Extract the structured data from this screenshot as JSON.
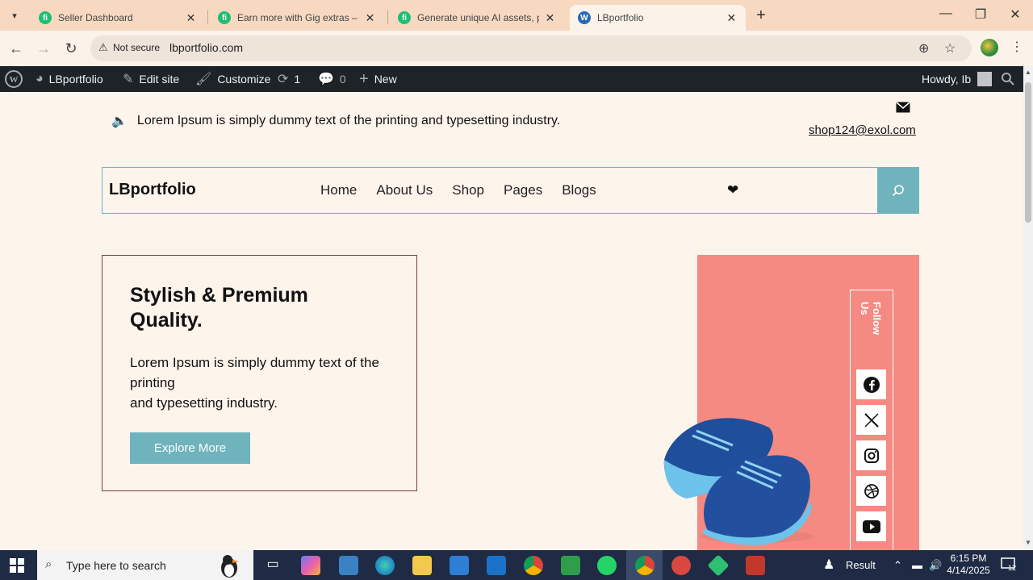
{
  "browser": {
    "tabs": [
      {
        "title": "Seller Dashboard",
        "favicon": "fiverr-icon"
      },
      {
        "title": "Earn more with Gig extras – Fiverr",
        "favicon": "fiverr-icon"
      },
      {
        "title": "Generate unique AI assets, pow",
        "favicon": "fiverr-icon"
      },
      {
        "title": "LBportfolio",
        "favicon": "wordpress-icon"
      }
    ],
    "security_label": "Not secure",
    "url": "lbportfolio.com"
  },
  "adminbar": {
    "site_name": "LBportfolio",
    "edit_site": "Edit site",
    "customize": "Customize",
    "updates_count": "1",
    "comments_count": "0",
    "new_label": "New",
    "howdy": "Howdy, Ib"
  },
  "page": {
    "announcement": "Lorem Ipsum is simply dummy text of the printing and typesetting industry.",
    "email": "shop124@exol.com",
    "logo": "LBportfolio",
    "menu": [
      "Home",
      "About Us",
      "Shop",
      "Pages",
      "Blogs"
    ],
    "hero": {
      "title": "Stylish & Premium Quality.",
      "text_line1": "Lorem Ipsum is simply dummy text of the printing",
      "text_line2": "and typesetting industry.",
      "button": "Explore More"
    },
    "follow_label": "Follow Us",
    "social": [
      "facebook-icon",
      "x-icon",
      "instagram-icon",
      "dribbble-icon",
      "youtube-icon"
    ],
    "colors": {
      "accent": "#6fb3bd",
      "panel": "#f48a82",
      "background": "#fdf4ec"
    }
  },
  "taskbar": {
    "search_placeholder": "Type here to search",
    "result_label": "Result",
    "time": "6:15 PM",
    "date": "4/14/2025",
    "notifications": "12"
  }
}
